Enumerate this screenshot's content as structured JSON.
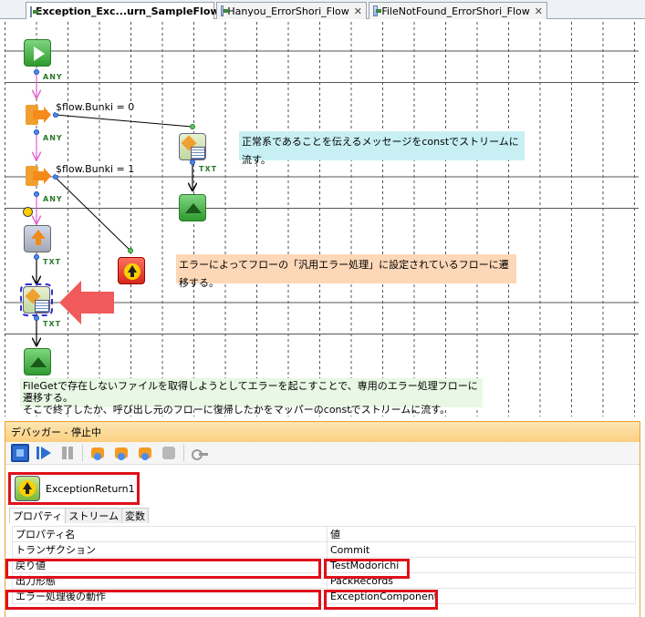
{
  "tabs": [
    {
      "label": "Exception_Exc...urn_SampleFlow",
      "active": true,
      "close": "✕"
    },
    {
      "label": "Hanyou_ErrorShori_Flow",
      "active": false,
      "close": "✕"
    },
    {
      "label": "FileNotFound_ErrorShori_Flow",
      "active": false,
      "close": "✕"
    }
  ],
  "flow": {
    "connectors": {
      "any": "ANY",
      "txt": "TXT"
    },
    "conditions": [
      "$flow.Bunki = 0",
      "$flow.Bunki = 1"
    ],
    "notes": {
      "normal": "正常系であることを伝えるメッセージをconstでストリームに流す。",
      "error": "エラーによってフローの「汎用エラー処理」に設定されているフローに遷移する。",
      "bottom_line1": "FileGetで存在しないファイルを取得しようとしてエラーを起こすことで、専用のエラー処理フローに遷移する。",
      "bottom_line2": "そこで終了したか、呼び出し元のフローに復帰したかをマッパーのconstでストリームに流す。"
    },
    "colors": {
      "note_cyan": "#c8f0f4",
      "note_orange": "#fdd8b8",
      "note_green": "#e8f8e4",
      "arrow_red": "#f05a5a"
    }
  },
  "debugger": {
    "title": "デバッガー - 停止中",
    "toolbar": [
      "stop-icon",
      "resume-icon",
      "pause-icon",
      "step-over-icon",
      "step-into-icon",
      "step-return-icon",
      "hand-icon",
      "key-icon"
    ],
    "component_name": "ExceptionReturn1",
    "tabs": [
      "プロパティ",
      "ストリーム",
      "変数"
    ],
    "table": {
      "headers": [
        "プロパティ名",
        "値"
      ],
      "rows": [
        [
          "トランザクション",
          "Commit"
        ],
        [
          "戻り値",
          "TestModorichi"
        ],
        [
          "出力形態",
          "PackRecords"
        ],
        [
          "エラー処理後の動作",
          "ExceptionComponent"
        ]
      ]
    }
  }
}
